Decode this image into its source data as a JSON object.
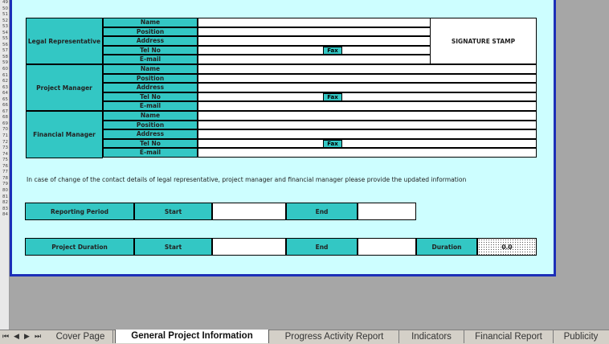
{
  "row_numbers": [
    "49",
    "50",
    "51",
    "52",
    "53",
    "54",
    "55",
    "56",
    "57",
    "58",
    "59",
    "60",
    "61",
    "62",
    "63",
    "64",
    "65",
    "66",
    "67",
    "68",
    "69",
    "70",
    "71",
    "72",
    "73",
    "74",
    "75",
    "76",
    "77",
    "78",
    "79",
    "80",
    "81",
    "82",
    "83",
    "84"
  ],
  "contacts": {
    "signature_stamp": "SIGNATURE STAMP",
    "fax_label": "Fax",
    "groups": [
      {
        "title": "Legal Representative",
        "fields": [
          "Name",
          "Position",
          "Address",
          "Tel No",
          "E-mail"
        ]
      },
      {
        "title": "Project Manager",
        "fields": [
          "Name",
          "Position",
          "Address",
          "Tel No",
          "E-mail"
        ]
      },
      {
        "title": "Financial Manager",
        "fields": [
          "Name",
          "Position",
          "Address",
          "Tel No",
          "E-mail"
        ]
      }
    ]
  },
  "note": "In case of change of the contact details of legal representative, project manager and financial manager please provide the updated information",
  "reporting_period": {
    "label": "Reporting Period",
    "start_label": "Start",
    "end_label": "End"
  },
  "project_duration": {
    "label": "Project Duration",
    "start_label": "Start",
    "end_label": "End",
    "duration_label": "Duration",
    "duration_value": "0.0"
  },
  "tabs": [
    "Cover Page",
    "General Project Information",
    "Progress Activity Report",
    "Indicators",
    "Financial Report",
    "Publicity"
  ],
  "active_tab": "General Project Information",
  "colors": {
    "accent": "#33c7c4",
    "panel": "#cdfeff",
    "border": "#1c2fb8"
  }
}
